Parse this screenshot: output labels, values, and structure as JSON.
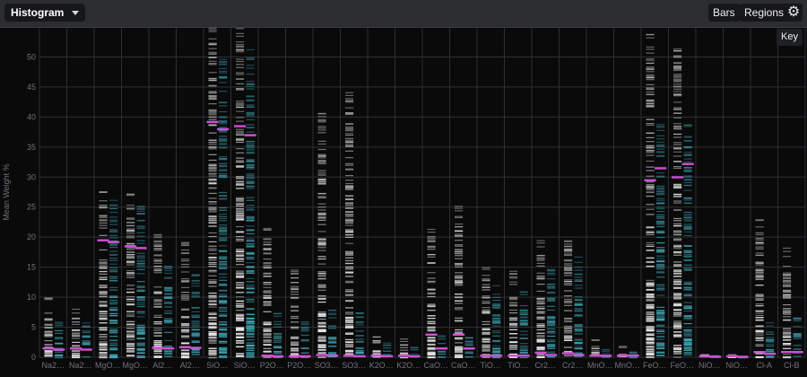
{
  "toolbar": {
    "view_label": "Histogram",
    "bars_label": "Bars",
    "regions_label": "Regions",
    "settings_icon": "gear-icon",
    "key_label": "Key"
  },
  "colors": {
    "background": "#0a0a0b",
    "toolbar": "#2b2d31",
    "grid": "#2c2f33",
    "strip_primary": "#e6e6e6",
    "strip_secondary": "#3fa6b3",
    "mean_marker": "#d24fd6"
  },
  "chart_data": {
    "type": "bar",
    "ylabel": "Mean Weight %",
    "ylim": [
      0,
      55
    ],
    "yticks": [
      0,
      5,
      10,
      15,
      20,
      25,
      30,
      35,
      40,
      45,
      50
    ],
    "grid": true,
    "categories": [
      "Na2…",
      "Na2…",
      "MgO…",
      "MgO…",
      "Al2…",
      "Al2…",
      "SiO…",
      "SiO…",
      "P2O…",
      "P2O…",
      "SO3…",
      "SO3…",
      "K2O…",
      "K2O…",
      "CaO…",
      "CaO…",
      "TiO…",
      "TiO…",
      "Cr2…",
      "Cr2…",
      "MnO…",
      "MnO…",
      "FeO…",
      "FeO…",
      "NiO…",
      "NiO…",
      "Cl-A",
      "Cl-B"
    ],
    "series": [
      {
        "values": [
          1.5,
          1.5,
          19.5,
          18.5,
          1.6,
          1.7,
          39.2,
          38.5,
          0.3,
          0.2,
          0.4,
          0.3,
          0.3,
          0.3,
          3.8,
          3.8,
          0.3,
          0.3,
          0.8,
          0.7,
          0.3,
          0.3,
          29.5,
          30.0,
          0.2,
          0.2,
          0.9,
          0.9
        ]
      },
      {
        "values": [
          1.3,
          1.3,
          19.2,
          18.2,
          1.5,
          1.6,
          38.0,
          37.0,
          0.2,
          0.2,
          0.3,
          0.2,
          0.2,
          0.2,
          1.5,
          1.5,
          0.3,
          0.3,
          0.4,
          0.4,
          0.3,
          0.3,
          31.5,
          32.2,
          0.1,
          0.1,
          0.6,
          0.9
        ]
      }
    ],
    "ranges": [
      [
        10.5,
        6.5
      ],
      [
        10.0,
        6.0
      ],
      [
        29.0,
        26.5
      ],
      [
        28.0,
        25.5
      ],
      [
        21.0,
        15.5
      ],
      [
        19.5,
        14.0
      ],
      [
        55,
        50
      ],
      [
        55,
        52
      ],
      [
        22.0,
        8.0
      ],
      [
        15.0,
        6.0
      ],
      [
        41.0,
        8.0
      ],
      [
        44.5,
        7.5
      ],
      [
        4.0,
        2.5
      ],
      [
        3.5,
        2.0
      ],
      [
        23.5,
        4.0
      ],
      [
        25.5,
        4.5
      ],
      [
        15.5,
        12.0
      ],
      [
        15.0,
        11.5
      ],
      [
        19.5,
        15.5
      ],
      [
        20.0,
        17.0
      ],
      [
        3.0,
        1.5
      ],
      [
        2.2,
        1.2
      ],
      [
        54.0,
        39.0
      ],
      [
        52.0,
        39.0
      ],
      [
        0.8,
        0.4
      ],
      [
        0.6,
        0.3
      ],
      [
        24.0,
        6.0
      ],
      [
        18.5,
        7.0
      ]
    ]
  }
}
